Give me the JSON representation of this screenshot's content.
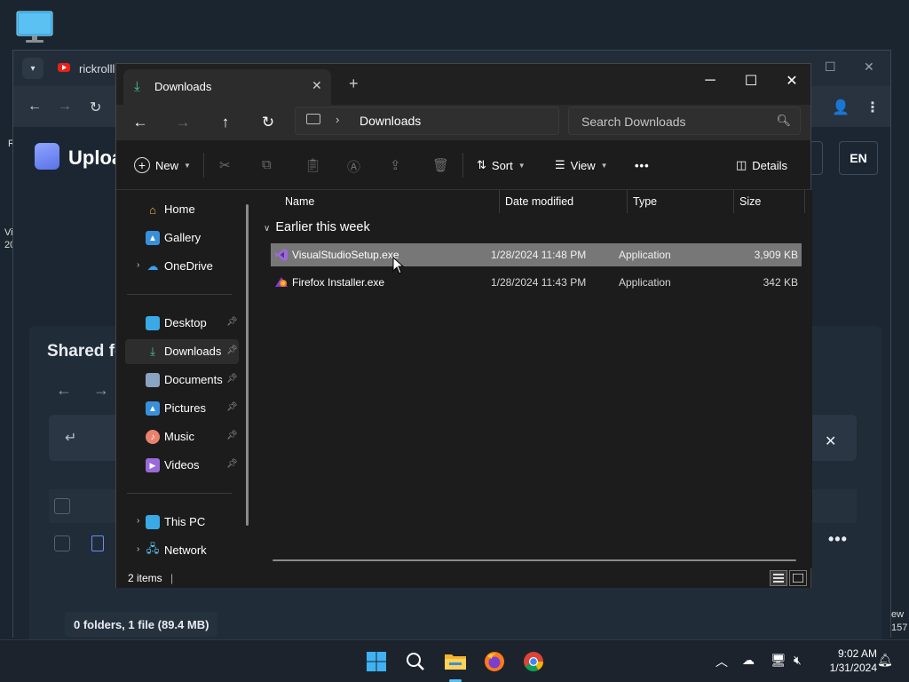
{
  "background_browser": {
    "tab_title": "rickrolll",
    "logo_text": "Uploa",
    "lang_button": "EN",
    "shared_title": "Shared fo",
    "footer_text": "0 folders, 1 file (89.4 MB)"
  },
  "desktop_fragments": {
    "left_r": "R",
    "left_vi": "Vi",
    "left_20": "20",
    "right_ew": "ew",
    "right_157": "157"
  },
  "explorer": {
    "tab_title": "Downloads",
    "address_segment": "Downloads",
    "search_placeholder": "Search Downloads",
    "toolbar": {
      "new_label": "New",
      "sort_label": "Sort",
      "view_label": "View",
      "more_label": "•••",
      "details_label": "Details"
    },
    "nav_items": [
      {
        "label": "Home"
      },
      {
        "label": "Gallery"
      },
      {
        "label": "OneDrive"
      },
      {
        "label": "Desktop"
      },
      {
        "label": "Downloads"
      },
      {
        "label": "Documents"
      },
      {
        "label": "Pictures"
      },
      {
        "label": "Music"
      },
      {
        "label": "Videos"
      },
      {
        "label": "This PC"
      },
      {
        "label": "Network"
      }
    ],
    "columns": {
      "name": "Name",
      "date": "Date modified",
      "type": "Type",
      "size": "Size"
    },
    "group_label": "Earlier this week",
    "files": [
      {
        "name": "VisualStudioSetup.exe",
        "date": "1/28/2024 11:48 PM",
        "type": "Application",
        "size": "3,909 KB"
      },
      {
        "name": "Firefox Installer.exe",
        "date": "1/28/2024 11:43 PM",
        "type": "Application",
        "size": "342 KB"
      }
    ],
    "status": "2 items"
  },
  "taskbar": {
    "time": "9:02 AM",
    "date": "1/31/2024"
  },
  "colors": {
    "selection": "#777777",
    "accent": "#4fc3a1",
    "explorer_bg": "#1c1c1c"
  }
}
